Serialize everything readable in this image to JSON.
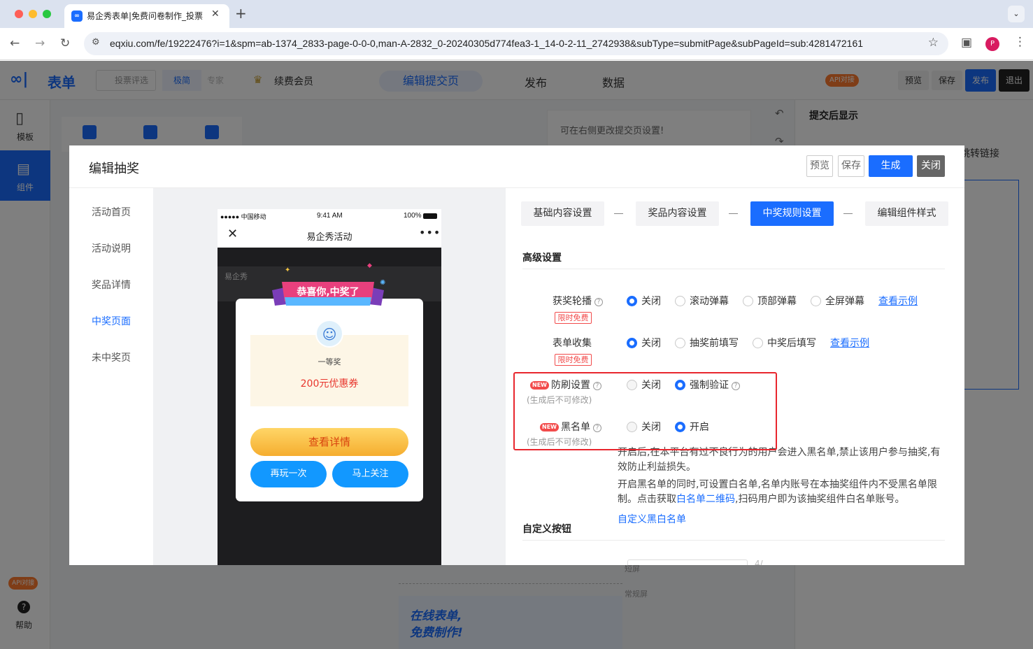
{
  "browser": {
    "tab_title": "易企秀表单|免费问卷制作_投票",
    "url": "eqxiu.com/fe/19222476?i=1&spm=ab-1374_2833-page-0-0-0,man-A-2832_0-20240305d774fea3-1_14-0-2-11_2742938&subType=submitPage&subPageId=sub:4281472161",
    "profile_initial": "P"
  },
  "app": {
    "logo_text": "表单",
    "header": {
      "vote_select": "投票评选",
      "mode_simple": "极简",
      "mode_pro": "专家",
      "renew_member": "续费会员",
      "edit_submit_page": "编辑提交页",
      "publish": "发布",
      "data": "数据",
      "api_badge": "API对接",
      "preview": "预览",
      "save": "保存",
      "publish_btn": "发布",
      "exit": "退出"
    },
    "left_rail": {
      "template": "模板",
      "component": "组件",
      "api_badge": "API对接",
      "help": "帮助"
    },
    "canvas_tip": "可在右侧更改提交页设置!",
    "right_panel": {
      "title": "提交后显示",
      "jump_link": "跳转链接"
    },
    "bg_labels": {
      "short_screen": "短屏",
      "normal_screen": "常规屏"
    },
    "promo": {
      "line1": "在线表单,",
      "line2": "免费制作!"
    }
  },
  "modal": {
    "title": "编辑抽奖",
    "buttons": {
      "preview": "预览",
      "save": "保存",
      "generate": "生成",
      "close": "关闭"
    },
    "side_nav": [
      "活动首页",
      "活动说明",
      "奖品详情",
      "中奖页面",
      "未中奖页"
    ],
    "side_nav_active": "中奖页面",
    "phone": {
      "carrier": "●●●●● 中国移动",
      "time": "9:41 AM",
      "battery": "100%",
      "title": "易企秀活动",
      "banner": "恭喜你,中奖了",
      "prize_level": "一等奖",
      "prize_name": "200元优惠券",
      "btn_details": "查看详情",
      "btn_replay": "再玩一次",
      "btn_follow": "马上关注",
      "bg_brand": "易企秀"
    },
    "steps": [
      "基础内容设置",
      "奖品内容设置",
      "中奖规则设置",
      "编辑组件样式"
    ],
    "steps_active": "中奖规则设置",
    "advanced_title": "高级设置",
    "rows": {
      "broadcast": {
        "label": "获奖轮播",
        "tag": "限时免费",
        "options": [
          "关闭",
          "滚动弹幕",
          "顶部弹幕",
          "全屏弹幕"
        ],
        "selected": "关闭",
        "example_link": "查看示例"
      },
      "form_collect": {
        "label": "表单收集",
        "tag": "限时免费",
        "options": [
          "关闭",
          "抽奖前填写",
          "中奖后填写"
        ],
        "selected": "关闭",
        "example_link": "查看示例"
      },
      "anti_brush": {
        "new_tag": "NEW",
        "label": "防刷设置",
        "note": "(生成后不可修改)",
        "options": [
          "关闭",
          "强制验证"
        ],
        "selected": "强制验证"
      },
      "blacklist": {
        "new_tag": "NEW",
        "label": "黑名单",
        "note": "(生成后不可修改)",
        "options": [
          "关闭",
          "开启"
        ],
        "selected": "开启"
      }
    },
    "blacklist_desc1": "开启后,在本平台有过不良行为的用户会进入黑名单,禁止该用户参与抽奖,有效防止利益损失。",
    "blacklist_desc2_a": "开启黑名单的同时,可设置白名单,名单内账号在本抽奖组件内不受黑名单限制。点击获取",
    "blacklist_desc2_link": "白名单二维码",
    "blacklist_desc2_b": ",扫码用户即为该抽奖组件白名单账号。",
    "custom_list_link": "自定义黑白名单",
    "custom_button_title": "自定义按钮",
    "char_count": "4/"
  },
  "colors": {
    "primary": "#1a6dff",
    "highlight_red": "#e8262d",
    "tag_red": "#f24b4b"
  }
}
